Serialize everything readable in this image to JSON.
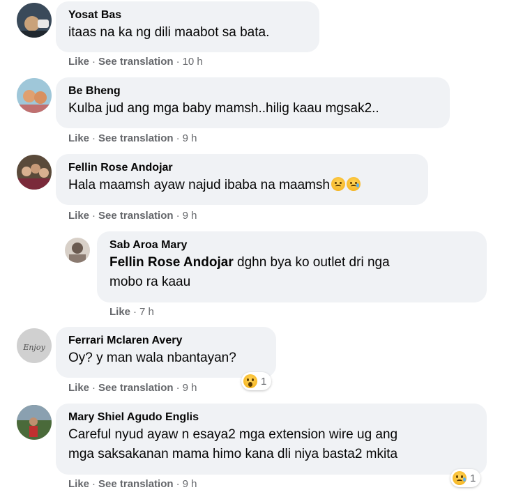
{
  "comments": [
    {
      "author": "Yosat Bas",
      "text": "itaas na ka ng dili maabot sa bata.",
      "like": "Like",
      "translate": "See translation",
      "time": "10 h",
      "avatar_colors": [
        "#3a4a5a",
        "#c9a27a"
      ]
    },
    {
      "author": "Be Bheng",
      "text": "Kulba jud ang mga baby mamsh..hilig kaau mgsak2..",
      "like": "Like",
      "translate": "See translation",
      "time": "9 h",
      "avatar_colors": [
        "#9fc7d9",
        "#e0a070"
      ]
    },
    {
      "author": "Fellin Rose Andojar",
      "text": "Hala maamsh ayaw najud ibaba na maamsh",
      "like": "Like",
      "translate": "See translation",
      "time": "9 h",
      "emoji": [
        "sad-emoji",
        "crying-emoji"
      ],
      "avatar_colors": [
        "#5a4a3a",
        "#d8b090"
      ],
      "replies": [
        {
          "author": "Sab Aroa Mary",
          "mention": "Fellin Rose Andojar",
          "text_line1": " dghn bya ko outlet dri nga",
          "text_line2": "mobo ra kaau",
          "like": "Like",
          "time": "7 h",
          "avatar_colors": [
            "#d8d0c8",
            "#6a5a50"
          ]
        }
      ]
    },
    {
      "author": "Ferrari Mclaren Avery",
      "text": "Oy? y man wala nbantayan?",
      "like": "Like",
      "translate": "See translation",
      "time": "9 h",
      "reaction": {
        "icon": "wow-emoji",
        "count": "1"
      },
      "avatar_colors": [
        "#d0d0d0",
        "#707070"
      ],
      "avatar_text": "Enjoy"
    },
    {
      "author": "Mary Shiel Agudo Englis",
      "text_line1": "Careful nyud ayaw n esaya2 mga extension wire ug ang",
      "text_line2": "mga saksakanan mama himo kana dli niya basta2 mkita",
      "like": "Like",
      "translate": "See translation",
      "time": "9 h",
      "reaction": {
        "icon": "sad-emoji",
        "count": "1"
      },
      "avatar_colors": [
        "#4a6a3a",
        "#c03030"
      ]
    }
  ],
  "separator": "·"
}
